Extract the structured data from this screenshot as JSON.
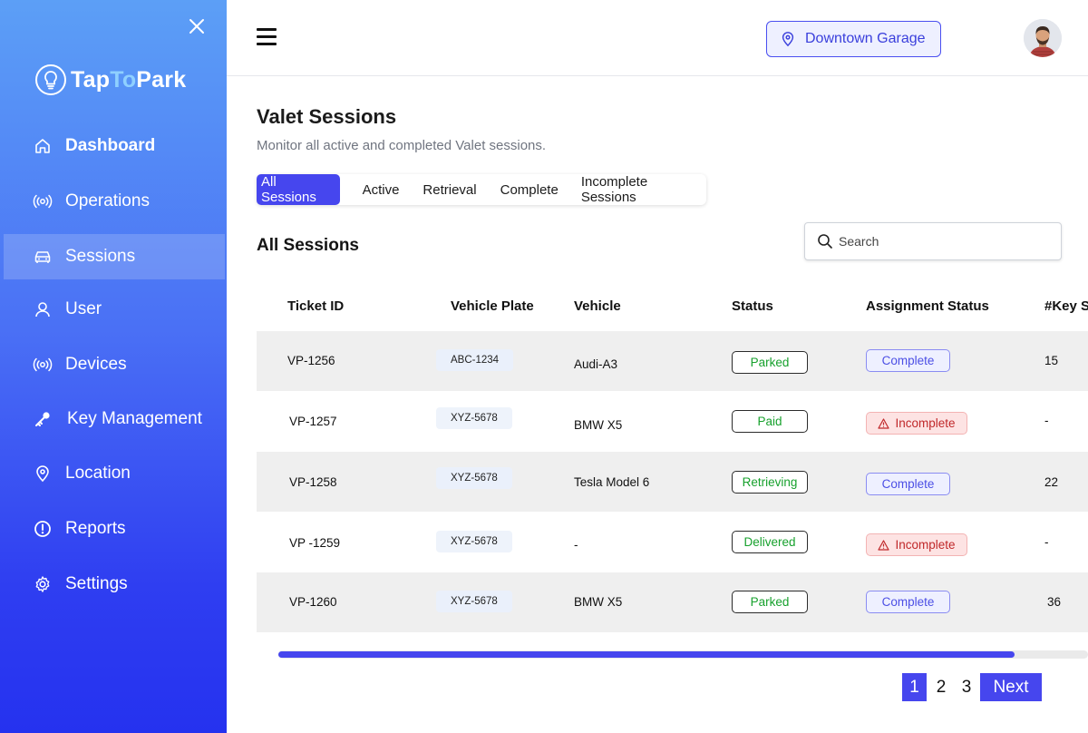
{
  "brand": {
    "name_part1": "Tap",
    "name_part2": "To",
    "name_part3": "Park"
  },
  "sidebar": {
    "items": [
      {
        "label": "Dashboard",
        "icon": "home-icon"
      },
      {
        "label": "Operations",
        "icon": "broadcast-icon"
      },
      {
        "label": "Sessions",
        "icon": "car-icon",
        "active": true
      },
      {
        "label": "User",
        "icon": "user-icon"
      },
      {
        "label": "Devices",
        "icon": "broadcast-icon"
      },
      {
        "label": "Key Management",
        "icon": "key-icon"
      },
      {
        "label": "Location",
        "icon": "location-pin-icon"
      },
      {
        "label": "Reports",
        "icon": "alert-circle-icon"
      },
      {
        "label": "Settings",
        "icon": "gear-icon"
      }
    ]
  },
  "header": {
    "location": "Downtown Garage"
  },
  "page": {
    "title": "Valet Sessions",
    "subtitle": "Monitor all active and completed Valet sessions.",
    "section_title": "All Sessions"
  },
  "tabs": [
    "All Sessions",
    "Active",
    "Retrieval",
    "Complete",
    "Incomplete Sessions"
  ],
  "search": {
    "placeholder": "Search",
    "value": ""
  },
  "table": {
    "columns": [
      "Ticket ID",
      "Vehicle Plate",
      "Vehicle",
      "Status",
      "Assignment Status",
      "#Key S"
    ],
    "rows": [
      {
        "ticket": "VP-1256",
        "plate": "ABC-1234",
        "vehicle": "Audi-A3",
        "status": "Parked",
        "assignment": "Complete",
        "key": "15"
      },
      {
        "ticket": "VP-1257",
        "plate": "XYZ-5678",
        "vehicle": "BMW X5",
        "status": "Paid",
        "assignment": "Incomplete",
        "key": "-"
      },
      {
        "ticket": "VP-1258",
        "plate": "XYZ-5678",
        "vehicle": "Tesla Model 6",
        "status": "Retrieving",
        "assignment": "Complete",
        "key": "22"
      },
      {
        "ticket": "VP -1259",
        "plate": "XYZ-5678",
        "vehicle": "-",
        "status": "Delivered",
        "assignment": "Incomplete",
        "key": "-"
      },
      {
        "ticket": "VP-1260",
        "plate": "XYZ-5678",
        "vehicle": "BMW X5",
        "status": "Parked",
        "assignment": "Complete",
        "key": "36"
      }
    ]
  },
  "pagination": {
    "pages": [
      "1",
      "2",
      "3"
    ],
    "current": "1",
    "next_label": "Next"
  },
  "colors": {
    "accent": "#4646ee",
    "status_green": "#17a12d",
    "incomplete_red": "#c0282a"
  }
}
